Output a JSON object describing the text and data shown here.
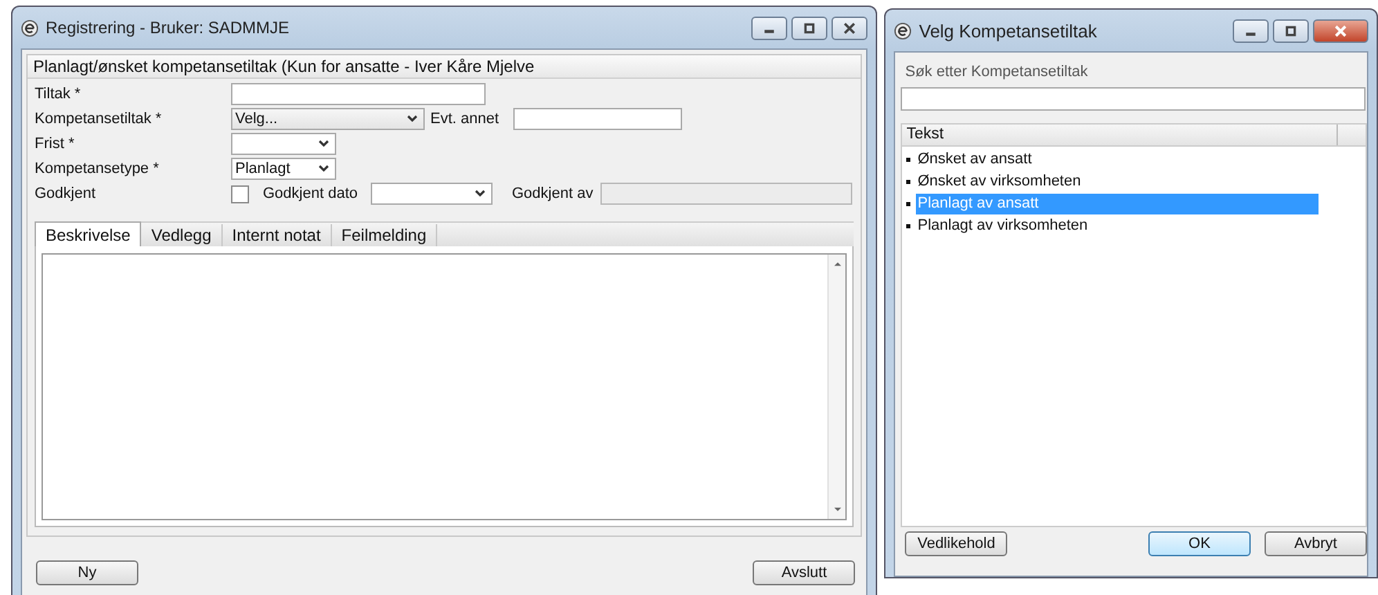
{
  "main_window": {
    "title": "Registrering - Bruker: SADMMJE",
    "section_title": "Planlagt/ønsket kompetansetiltak (Kun for ansatte - Iver Kåre Mjelve",
    "fields": [
      {
        "kind": "text",
        "label": "Tiltak *"
      },
      {
        "kind": "combo",
        "label": "Kompetansetiltak *",
        "value": "Velg...",
        "extra_label": "Evt. annet"
      },
      {
        "kind": "combo",
        "label": "Frist *"
      },
      {
        "kind": "combo",
        "label": "Kompetansetype *",
        "value": "Planlagt"
      },
      {
        "kind": "approval",
        "label": "Godkjent",
        "checked": false,
        "date_label": "Godkjent dato",
        "by_label": "Godkjent av"
      }
    ],
    "tabs": [
      {
        "label": "Beskrivelse",
        "selected": true
      },
      {
        "label": "Vedlegg",
        "selected": false
      },
      {
        "label": "Internt notat",
        "selected": false
      },
      {
        "label": "Feilmelding",
        "selected": false
      }
    ],
    "buttons": [
      "Ny",
      "Avslutt"
    ]
  },
  "dialog": {
    "title": "Velg Kompetansetiltak",
    "search_label": "Søk etter Kompetansetiltak",
    "column": "Tekst",
    "items": [
      {
        "label": "Ønsket av ansatt",
        "selected": false
      },
      {
        "label": "Ønsket av virksomheten",
        "selected": false
      },
      {
        "label": "Planlagt av ansatt",
        "selected": true
      },
      {
        "label": "Planlagt av virksomheten",
        "selected": false
      }
    ],
    "buttons": [
      {
        "label": "Vedlikehold",
        "default": false
      },
      {
        "label": "OK",
        "default": true
      },
      {
        "label": "Avbryt",
        "default": false
      }
    ]
  }
}
